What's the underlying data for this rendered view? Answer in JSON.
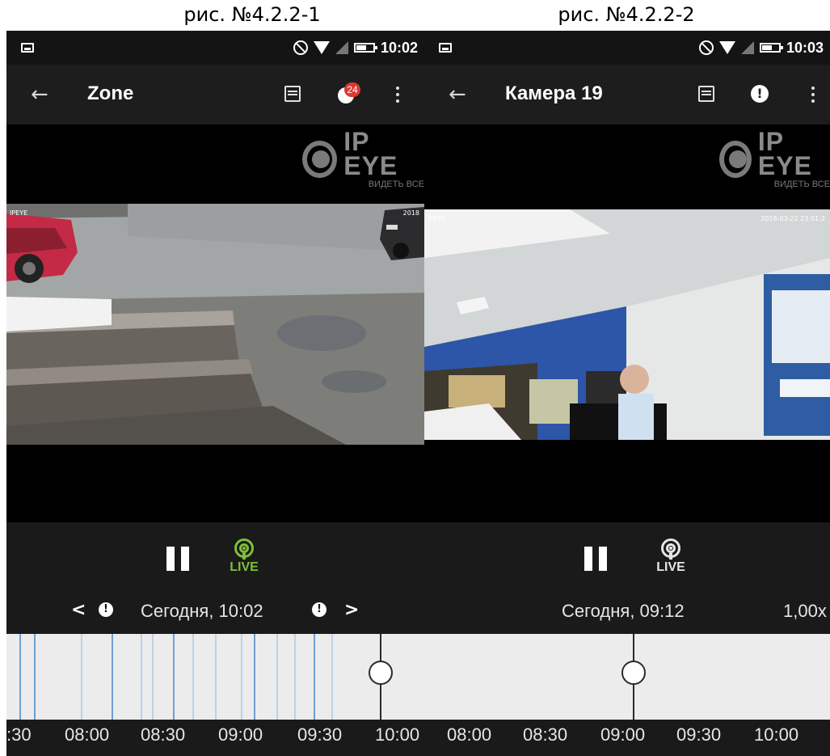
{
  "captions": [
    "рис. №4.2.2-1",
    "рис. №4.2.2-2"
  ],
  "screens": [
    {
      "status_time": "10:02",
      "title": "Zone",
      "notification_count": "24",
      "watermark": {
        "brand": "IP EYE",
        "tagline": "ВИДЕТЬ ВСЕ"
      },
      "frame_left_tag": "IPEYE",
      "frame_right_tag": "2018",
      "live_label": "LIVE",
      "live_active": true,
      "date_text": "Сегодня, 10:02",
      "alert_glyph": "!",
      "prev_glyph": "<",
      "next_glyph": ">",
      "ticks": [
        ":30",
        "08:00",
        "08:30",
        "09:00",
        "09:30",
        "10:00"
      ]
    },
    {
      "status_time": "10:03",
      "title": "Камера 19",
      "alert_glyph": "!",
      "watermark": {
        "brand": "IP EYE",
        "tagline": "ВИДЕТЬ ВСЕ"
      },
      "frame_left_tag": "IPEYE",
      "frame_right_tag": "2018-03-22 23:01:2",
      "live_label": "LIVE",
      "live_active": false,
      "date_text": "Сегодня, 09:12",
      "speed_text": "1,00x",
      "ticks": [
        "08:00",
        "08:30",
        "09:00",
        "09:30",
        "10:00"
      ]
    }
  ],
  "icons": {
    "back": "←",
    "live_active_color": "#7fbf3a",
    "badge_color": "#e0362f",
    "timeline_mark_color": "#6fa0d2"
  }
}
